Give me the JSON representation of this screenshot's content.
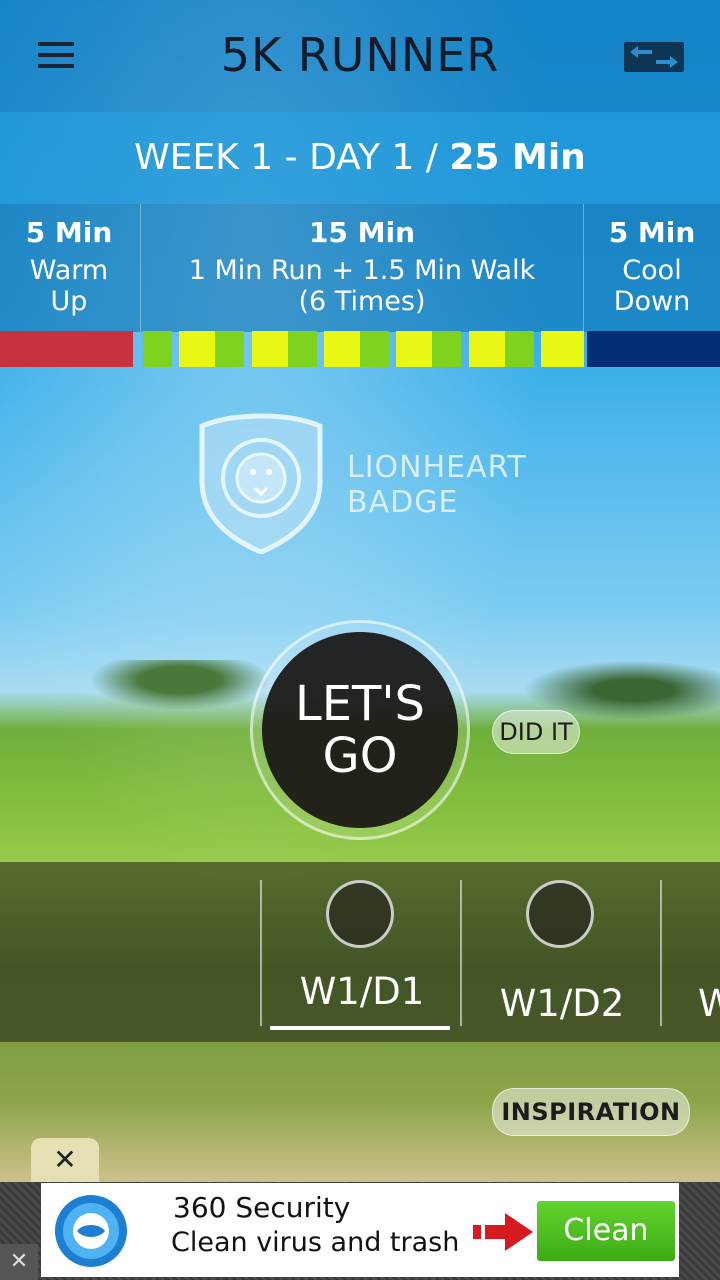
{
  "header": {
    "title": "5K RUNNER",
    "menu_icon": "hamburger-menu-icon",
    "switch_icon": "swap-arrows-icon"
  },
  "week": {
    "label": "WEEK 1 - DAY 1 / ",
    "total": "25 Min"
  },
  "segments": [
    {
      "duration": "5 Min",
      "line1": "Warm",
      "line2": "Up",
      "color": "#c8323e"
    },
    {
      "duration": "15 Min",
      "line1": "1 Min Run + 1.5 Min Walk",
      "line2": "(6 Times)",
      "run_color": "#e9f713",
      "walk_color": "#7ed321"
    },
    {
      "duration": "5 Min",
      "line1": "Cool",
      "line2": "Down",
      "color": "#052d73"
    }
  ],
  "badge": {
    "line1": "LIONHEART",
    "line2": "BADGE",
    "icon": "lion-shield-icon"
  },
  "go_button": {
    "line1": "LET'S",
    "line2": "GO"
  },
  "did_it": "DID IT",
  "days": [
    {
      "label": "W1/D1",
      "selected": true
    },
    {
      "label": "W1/D2",
      "selected": false
    },
    {
      "label": "W",
      "selected": false
    }
  ],
  "inspiration": "INSPIRATION",
  "ad": {
    "close_tab": "✕",
    "title": "360 Security",
    "subtitle": "Clean virus and trash",
    "button": "Clean",
    "corner_close": "✕"
  }
}
